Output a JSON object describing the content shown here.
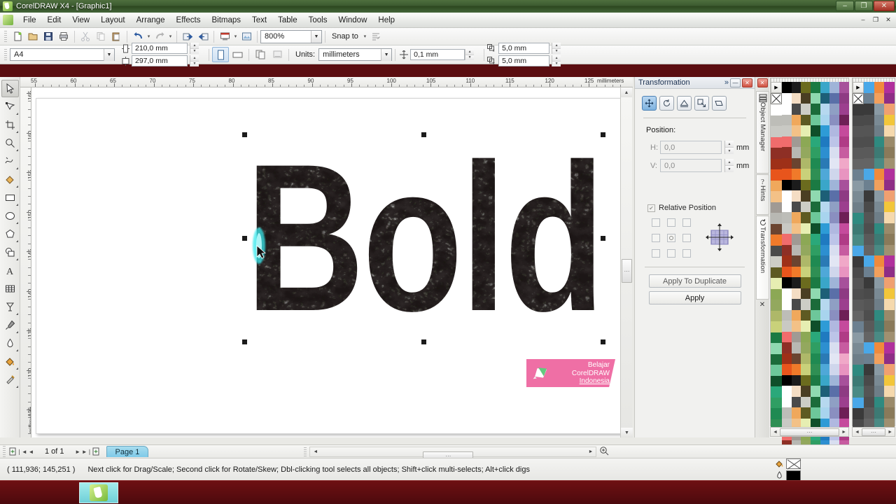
{
  "window": {
    "title": "CorelDRAW X4 - [Graphic1]",
    "minimize": "–",
    "maximize": "❐",
    "close": "✕",
    "mdi_minimize": "–",
    "mdi_restore": "❐",
    "mdi_close": "✕"
  },
  "menu": {
    "items": [
      "File",
      "Edit",
      "View",
      "Layout",
      "Arrange",
      "Effects",
      "Bitmaps",
      "Text",
      "Table",
      "Tools",
      "Window",
      "Help"
    ]
  },
  "toolbar": {
    "buttons": [
      {
        "name": "new-document",
        "glyph": "📄"
      },
      {
        "name": "open-document",
        "glyph": "📂"
      },
      {
        "name": "save-document",
        "glyph": "💾"
      },
      {
        "name": "print-document",
        "glyph": "🖨"
      },
      {
        "name": "cut",
        "glyph": "✂"
      },
      {
        "name": "copy",
        "glyph": "⧉"
      },
      {
        "name": "paste",
        "glyph": "📋"
      },
      {
        "name": "undo",
        "glyph": "↶"
      },
      {
        "name": "redo",
        "glyph": "↷"
      },
      {
        "name": "import",
        "glyph": "⇥"
      },
      {
        "name": "export",
        "glyph": "⇤"
      },
      {
        "name": "application-launcher",
        "glyph": "▤"
      },
      {
        "name": "welcome-screen",
        "glyph": "▣"
      }
    ],
    "zoom_level": "800%",
    "snap_to_label": "Snap to",
    "options_tooltip": "Options"
  },
  "propertybar": {
    "paper_type": "A4",
    "page_width": "210,0 mm",
    "page_height": "297,0 mm",
    "portrait_tooltip": "Portrait",
    "landscape_tooltip": "Landscape",
    "units_label": "Units:",
    "units_value": "millimeters",
    "nudge_offset": "0,1 mm",
    "duplicate_x": "5,0 mm",
    "duplicate_y": "5,0 mm"
  },
  "toolbox": {
    "tools": [
      {
        "name": "pick-tool",
        "glyph": "➤",
        "active": true,
        "flyout": false
      },
      {
        "name": "shape-tool",
        "glyph": "◥",
        "active": false,
        "flyout": true
      },
      {
        "name": "crop-tool",
        "glyph": "✄",
        "active": false,
        "flyout": true
      },
      {
        "name": "zoom-tool",
        "glyph": "🔍",
        "active": false,
        "flyout": true
      },
      {
        "name": "freehand-tool",
        "glyph": "✎",
        "active": false,
        "flyout": true
      },
      {
        "name": "smart-fill-tool",
        "glyph": "🖌",
        "active": false,
        "flyout": true
      },
      {
        "name": "rectangle-tool",
        "glyph": "▭",
        "active": false,
        "flyout": true
      },
      {
        "name": "ellipse-tool",
        "glyph": "◯",
        "active": false,
        "flyout": true
      },
      {
        "name": "polygon-tool",
        "glyph": "⬡",
        "active": false,
        "flyout": true
      },
      {
        "name": "basic-shapes-tool",
        "glyph": "◳",
        "active": false,
        "flyout": true
      },
      {
        "name": "text-tool",
        "glyph": "A",
        "active": false,
        "flyout": false
      },
      {
        "name": "table-tool",
        "glyph": "▦",
        "active": false,
        "flyout": false
      },
      {
        "name": "blend-tool",
        "glyph": "Y",
        "active": false,
        "flyout": true
      },
      {
        "name": "eyedropper-tool",
        "glyph": "⚲",
        "active": false,
        "flyout": true
      },
      {
        "name": "outline-tool",
        "glyph": "✒",
        "active": false,
        "flyout": true
      },
      {
        "name": "fill-tool",
        "glyph": "🪣",
        "active": false,
        "flyout": true
      },
      {
        "name": "interactive-fill-tool",
        "glyph": "◗",
        "active": false,
        "flyout": true
      }
    ]
  },
  "rulers": {
    "horizontal_ticks": [
      "55",
      "60",
      "65",
      "70",
      "75",
      "80",
      "85",
      "90",
      "95",
      "100",
      "105",
      "110",
      "115",
      "120",
      "125"
    ],
    "horizontal_unit": "millimeters",
    "vertical_ticks": [
      "165",
      "160",
      "155",
      "150",
      "145",
      "140",
      "135",
      "130",
      "125"
    ],
    "vertical_unit": "millimeters"
  },
  "canvas": {
    "artwork_text": "Bold",
    "watermark": {
      "line1": "Belajar",
      "line2": "CorelDRAW",
      "line3": "Indonesia",
      "color": "#ef6fa5"
    }
  },
  "docker": {
    "title": "Transformation",
    "expand_glyph": "»",
    "minimize_glyph": "—",
    "close_glyph": "✕",
    "mode_buttons": [
      {
        "name": "position-mode",
        "glyph": "✛",
        "selected": true
      },
      {
        "name": "rotate-mode",
        "glyph": "↺",
        "selected": false
      },
      {
        "name": "scale-mirror-mode",
        "glyph": "⇲",
        "selected": false
      },
      {
        "name": "size-mode",
        "glyph": "⤡",
        "selected": false
      },
      {
        "name": "skew-mode",
        "glyph": "▱",
        "selected": false
      }
    ],
    "position_label": "Position:",
    "h_label": "H:",
    "h_value": "0,0",
    "h_unit": "mm",
    "v_label": "V:",
    "v_value": "0,0",
    "v_unit": "mm",
    "relative_position_label": "Relative Position",
    "relative_position_checked": true,
    "apply_to_duplicate_label": "Apply To Duplicate",
    "apply_label": "Apply",
    "tabs": [
      "Object Manager",
      "Hints",
      "Transformation"
    ]
  },
  "palette": {
    "no_color_glyph": "✕",
    "scroll_up": "◄",
    "scroll_down": "►",
    "grip": "⋮⋮",
    "left_colors": [
      [
        "#000000",
        "#1c1c1c",
        "#6b6b1e",
        "#1b7a43",
        "#3aa6c9",
        "#9fb4d8",
        "#a7519b"
      ],
      [
        "#ffffff",
        "#f4ddc4",
        "#4a3e23",
        "#8fd9b0",
        "#1d5f77",
        "#5a6fa8",
        "#8e3b83"
      ],
      [
        "#ffffff",
        "#4a4a4a",
        "#cdcdc6",
        "#1b6b3a",
        "#b6d8ef",
        "#8f9fc4",
        "#9c3f8e"
      ],
      [
        "#bdbdb8",
        "#f0a85c",
        "#5e5a22",
        "#6dc79a",
        "#a8d4ee",
        "#8a8fc0",
        "#6e1f56"
      ],
      [
        "#c9c9c4",
        "#f3c187",
        "#e6eeb2",
        "#0f4f2a",
        "#2e9bd6",
        "#b0b8e0",
        "#c54b9c"
      ],
      [
        "#f06c6c",
        "#a09a94",
        "#8ca855",
        "#2aa87a",
        "#1f7ac0",
        "#bcc4e8",
        "#b03b86"
      ],
      [
        "#8e2f25",
        "#b8b8b3",
        "#93a85e",
        "#2f9e63",
        "#2d8fd0",
        "#d8def0",
        "#c75ca0"
      ],
      [
        "#9e3018",
        "#6b4430",
        "#aeb869",
        "#1f8a52",
        "#2a7ab5",
        "#e2e6f4",
        "#f0a8c8"
      ],
      [
        "#e8551c",
        "#f07a2a",
        "#c9d17a",
        "#2f8f54",
        "#4fa8d8",
        "#cfd6ec",
        "#e894c0"
      ]
    ],
    "right_colors": [
      [
        "#4aa8e8",
        "#f08a3c",
        "#b0309c"
      ],
      [
        "#6c8090",
        "#f2a05c",
        "#8e2e86"
      ],
      [
        "#3a3a3a",
        "#8a9aa4",
        "#f0a070"
      ],
      [
        "#4a4a4a",
        "#7a8a94",
        "#f2c63a"
      ],
      [
        "#555555",
        "#6e7e88",
        "#f5d9ad"
      ],
      [
        "#4e4e4e",
        "#2f8a80",
        "#9a8a6a"
      ],
      [
        "#5a5a5a",
        "#3d7a74",
        "#8a7a5a"
      ],
      [
        "#646464",
        "#4a8a84",
        "#a09070"
      ]
    ]
  },
  "pagebar": {
    "first_glyph": "❘◄",
    "prev_glyph": "◄",
    "page_count": "1 of 1",
    "next_glyph": "►",
    "last_glyph": "►❘",
    "add_page_glyph": "▤",
    "page_tab": "Page 1",
    "hscroll_left": "◄",
    "hscroll_right": "►",
    "zoom_glyph": "🔍"
  },
  "statusbar": {
    "coordinates": "( 111,936; 145,251 )",
    "hint": "Next click for Drag/Scale; Second click for Rotate/Skew; Dbl-clicking tool selects all objects; Shift+click multi-selects; Alt+click digs",
    "fill_label": "fill-indicator",
    "outline_label": "outline-indicator",
    "outline_color": "#000000"
  },
  "taskbar": {
    "item_name": "CorelDRAW X4"
  }
}
